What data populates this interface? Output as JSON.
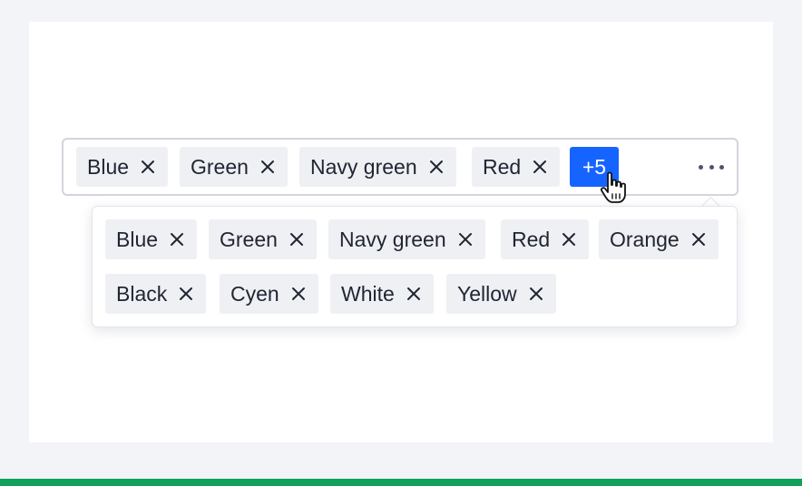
{
  "select": {
    "visible_tags": [
      {
        "label": "Blue"
      },
      {
        "label": "Green"
      },
      {
        "label": "Navy green"
      },
      {
        "label": "Red"
      }
    ],
    "overflow_label": "+5",
    "more_icon": "ellipsis-icon"
  },
  "popover": {
    "tags": [
      {
        "label": "Blue"
      },
      {
        "label": "Green"
      },
      {
        "label": "Navy green"
      },
      {
        "label": "Red"
      },
      {
        "label": "Orange"
      },
      {
        "label": "Black"
      },
      {
        "label": "Cyen"
      },
      {
        "label": "White"
      },
      {
        "label": "Yellow"
      }
    ]
  },
  "icons": {
    "remove": "close-icon",
    "cursor": "hand-pointer-icon"
  },
  "colors": {
    "accent": "#1664ff",
    "tag_bg": "#eff0f3",
    "footer_bar": "#10a05a"
  }
}
